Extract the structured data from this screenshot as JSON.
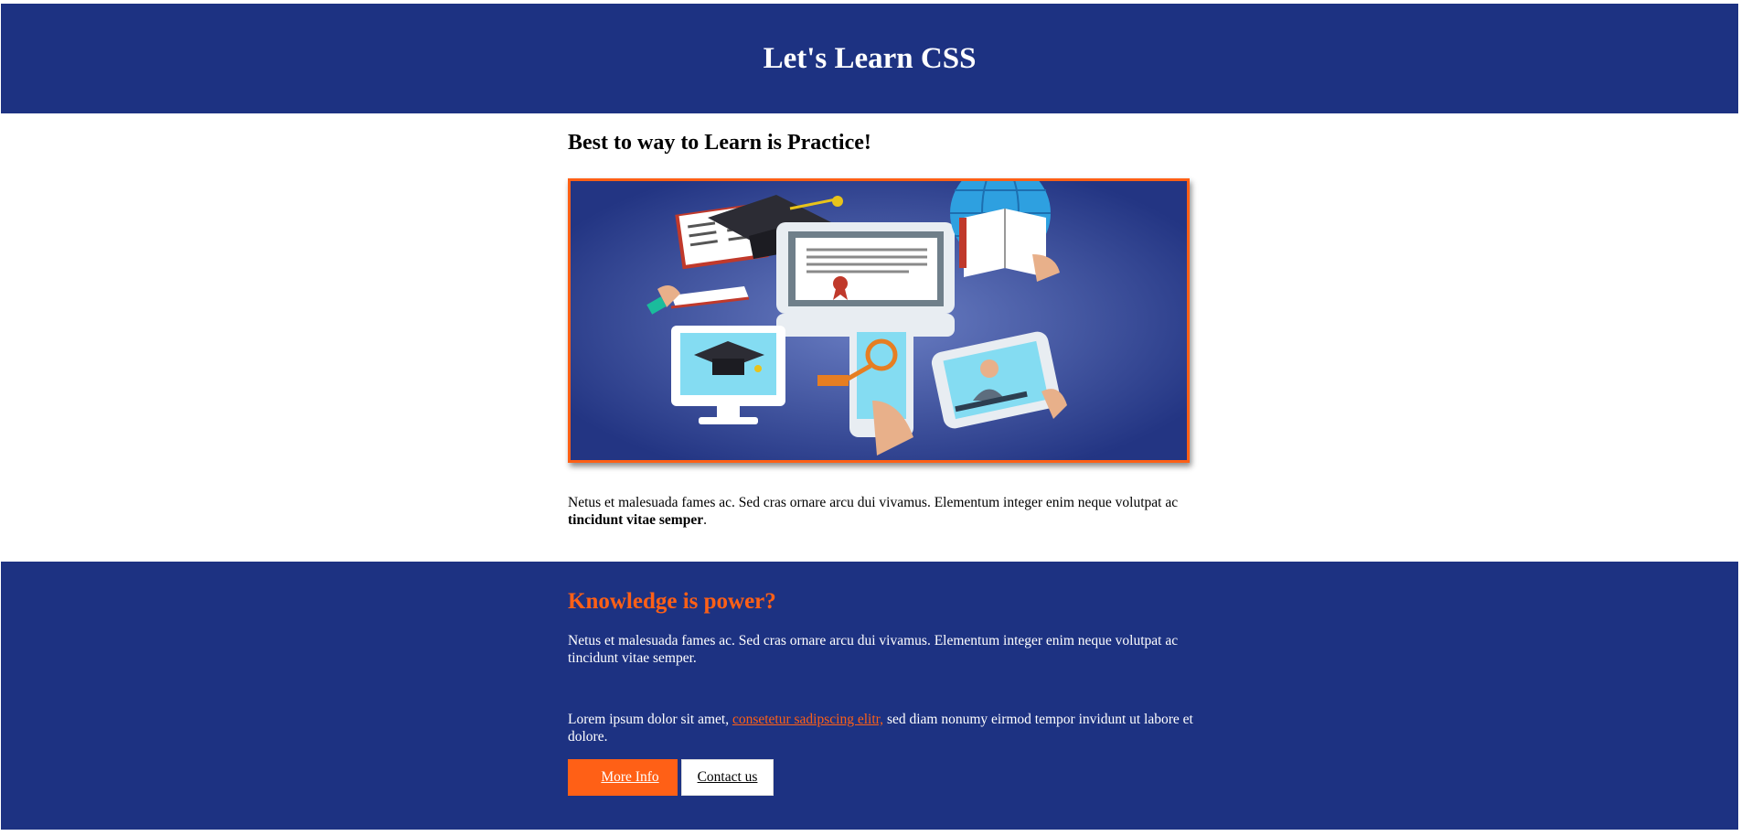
{
  "header": {
    "title": "Let's Learn CSS"
  },
  "main": {
    "subtitle": "Best to way to Learn is Practice!",
    "intro_text": "Netus et malesuada fames ac. Sed cras ornare arcu dui vivamus. Elementum integer enim neque volutpat ac ",
    "intro_bold": "tincidunt vitae semper",
    "intro_end": "."
  },
  "footer": {
    "heading": "Knowledge is power?",
    "paragraph1": "Netus et malesuada fames ac. Sed cras ornare arcu dui vivamus. Elementum integer enim neque volutpat ac tincidunt vitae semper.",
    "paragraph2_start": "Lorem ipsum dolor sit amet, ",
    "paragraph2_link": "consetetur sadipscing elitr,",
    "paragraph2_end": " sed diam nonumy eirmod tempor invidunt ut labore et dolore.",
    "more_info_label": "More Info",
    "contact_label": "Contact us"
  },
  "colors": {
    "navy": "#1d3282",
    "accent": "#ff6016",
    "white": "#ffffff"
  },
  "icons": [
    "education-illustration"
  ]
}
